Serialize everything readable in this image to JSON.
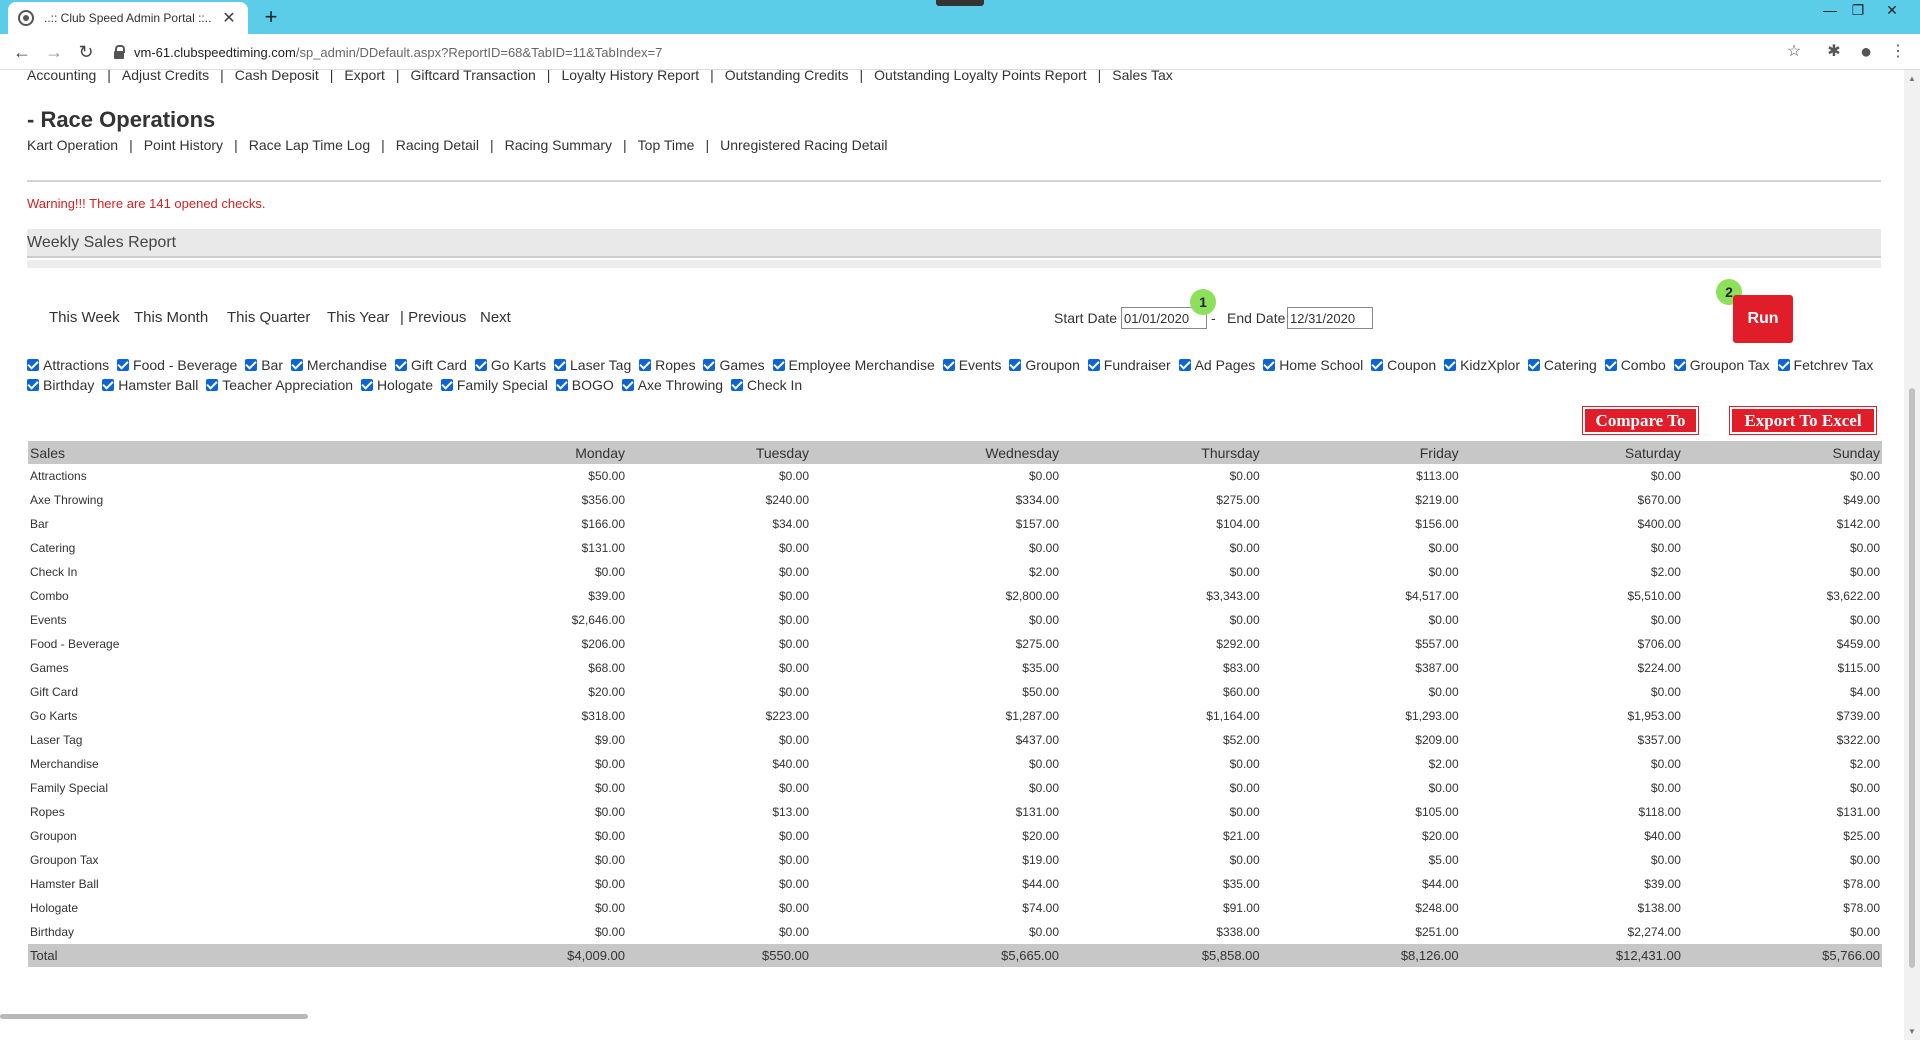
{
  "browser": {
    "tab_title": "..:: Club Speed Admin Portal ::..",
    "url_host": "vm-61.clubspeedtiming.com",
    "url_path": "/sp_admin/DDefault.aspx?ReportID=68&TabID=11&TabIndex=7"
  },
  "finance_links": [
    "Accounting",
    "Adjust Credits",
    "Cash Deposit",
    "Export",
    "Giftcard Transaction",
    "Loyalty History Report",
    "Outstanding Credits",
    "Outstanding Loyalty Points Report",
    "Sales Tax"
  ],
  "race_ops": {
    "heading": "- Race Operations",
    "links": [
      "Kart Operation",
      "Point History",
      "Race Lap Time Log",
      "Racing Detail",
      "Racing Summary",
      "Top Time",
      "Unregistered Racing Detail"
    ]
  },
  "warning": "Warning!!! There are 141 opened checks.",
  "report_title": "Weekly Sales Report",
  "quick_ranges": [
    "This Week",
    "This Month",
    "This Quarter",
    "This Year",
    "| Previous",
    "Next"
  ],
  "dates": {
    "start_label": "Start Date",
    "start_value": "01/01/2020",
    "separator": "-",
    "end_label": "End Date",
    "end_value": "12/31/2020"
  },
  "steps": [
    "1",
    "2"
  ],
  "run_label": "Run",
  "categories": [
    "Attractions",
    "Food - Beverage",
    "Bar",
    "Merchandise",
    "Gift Card",
    "Go Karts",
    "Laser Tag",
    "Ropes",
    "Games",
    "Employee Merchandise",
    "Events",
    "Groupon",
    "Fundraiser",
    "Ad Pages",
    "Home School",
    "Coupon",
    "KidzXplor",
    "Catering",
    "Combo",
    "Groupon Tax",
    "Fetchrev Tax",
    "Birthday",
    "Hamster Ball",
    "Teacher Appreciation",
    "Hologate",
    "Family Special",
    "BOGO",
    "Axe Throwing",
    "Check In"
  ],
  "compare_label": "Compare To",
  "export_label": "Export To Excel",
  "table": {
    "headers": [
      "Sales",
      "Monday",
      "Tuesday",
      "Wednesday",
      "Thursday",
      "Friday",
      "Saturday",
      "Sunday"
    ],
    "rows": [
      [
        "Attractions",
        "$50.00",
        "$0.00",
        "$0.00",
        "$0.00",
        "$113.00",
        "$0.00",
        "$0.00"
      ],
      [
        "Axe Throwing",
        "$356.00",
        "$240.00",
        "$334.00",
        "$275.00",
        "$219.00",
        "$670.00",
        "$49.00"
      ],
      [
        "Bar",
        "$166.00",
        "$34.00",
        "$157.00",
        "$104.00",
        "$156.00",
        "$400.00",
        "$142.00"
      ],
      [
        "Catering",
        "$131.00",
        "$0.00",
        "$0.00",
        "$0.00",
        "$0.00",
        "$0.00",
        "$0.00"
      ],
      [
        "Check In",
        "$0.00",
        "$0.00",
        "$2.00",
        "$0.00",
        "$0.00",
        "$2.00",
        "$0.00"
      ],
      [
        "Combo",
        "$39.00",
        "$0.00",
        "$2,800.00",
        "$3,343.00",
        "$4,517.00",
        "$5,510.00",
        "$3,622.00"
      ],
      [
        "Events",
        "$2,646.00",
        "$0.00",
        "$0.00",
        "$0.00",
        "$0.00",
        "$0.00",
        "$0.00"
      ],
      [
        "Food - Beverage",
        "$206.00",
        "$0.00",
        "$275.00",
        "$292.00",
        "$557.00",
        "$706.00",
        "$459.00"
      ],
      [
        "Games",
        "$68.00",
        "$0.00",
        "$35.00",
        "$83.00",
        "$387.00",
        "$224.00",
        "$115.00"
      ],
      [
        "Gift Card",
        "$20.00",
        "$0.00",
        "$50.00",
        "$60.00",
        "$0.00",
        "$0.00",
        "$4.00"
      ],
      [
        "Go Karts",
        "$318.00",
        "$223.00",
        "$1,287.00",
        "$1,164.00",
        "$1,293.00",
        "$1,953.00",
        "$739.00"
      ],
      [
        "Laser Tag",
        "$9.00",
        "$0.00",
        "$437.00",
        "$52.00",
        "$209.00",
        "$357.00",
        "$322.00"
      ],
      [
        "Merchandise",
        "$0.00",
        "$40.00",
        "$0.00",
        "$0.00",
        "$2.00",
        "$0.00",
        "$2.00"
      ],
      [
        "Family Special",
        "$0.00",
        "$0.00",
        "$0.00",
        "$0.00",
        "$0.00",
        "$0.00",
        "$0.00"
      ],
      [
        "Ropes",
        "$0.00",
        "$13.00",
        "$131.00",
        "$0.00",
        "$105.00",
        "$118.00",
        "$131.00"
      ],
      [
        "Groupon",
        "$0.00",
        "$0.00",
        "$20.00",
        "$21.00",
        "$20.00",
        "$40.00",
        "$25.00"
      ],
      [
        "Groupon Tax",
        "$0.00",
        "$0.00",
        "$19.00",
        "$0.00",
        "$5.00",
        "$0.00",
        "$0.00"
      ],
      [
        "Hamster Ball",
        "$0.00",
        "$0.00",
        "$44.00",
        "$35.00",
        "$44.00",
        "$39.00",
        "$78.00"
      ],
      [
        "Hologate",
        "$0.00",
        "$0.00",
        "$74.00",
        "$91.00",
        "$248.00",
        "$138.00",
        "$78.00"
      ],
      [
        "Birthday",
        "$0.00",
        "$0.00",
        "$0.00",
        "$338.00",
        "$251.00",
        "$2,274.00",
        "$0.00"
      ]
    ],
    "total": [
      "Total",
      "$4,009.00",
      "$550.00",
      "$5,665.00",
      "$5,858.00",
      "$8,126.00",
      "$12,431.00",
      "$5,766.00"
    ]
  }
}
